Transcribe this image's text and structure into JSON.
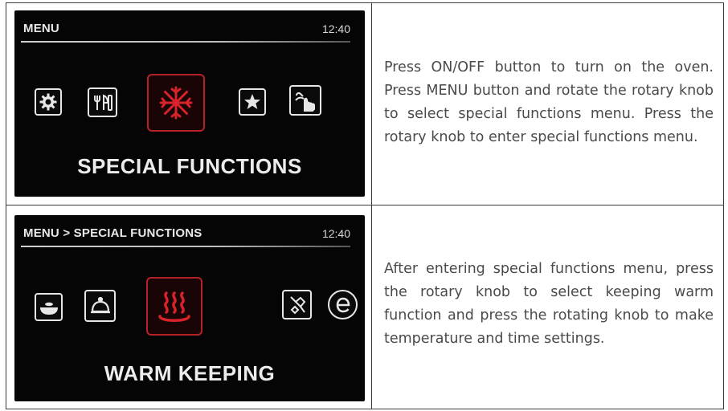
{
  "rows": [
    {
      "screen": {
        "header": "MENU",
        "clock": "12:40",
        "label": "SPECIAL FUNCTIONS",
        "icons": [
          "settings-gear-icon",
          "cutlery-icon",
          "special-functions-icon",
          "star-icon",
          "hand-touch-icon"
        ],
        "selected_icon": "special-functions-icon"
      },
      "description": "Press ON/OFF button to turn on the oven. Press MENU button and rotate the rotary knob to select special functions menu. Press the rotary knob to enter special functions menu."
    },
    {
      "screen": {
        "header": "MENU > SPECIAL FUNCTIONS",
        "clock": "12:40",
        "label": "WARM KEEPING",
        "icons": [
          "pot-icon",
          "cloche-icon",
          "warm-keeping-icon",
          "cleaning-icon",
          "eco-icon"
        ],
        "selected_icon": "warm-keeping-icon"
      },
      "description": "After entering special functions menu, press the rotary knob to select keeping warm function and press the rotating knob to make temperature and time settings."
    }
  ],
  "colors": {
    "screen_bg": "#050505",
    "highlight": "#b52126",
    "text": "#4a4a4a",
    "border": "#3a3a3a"
  }
}
